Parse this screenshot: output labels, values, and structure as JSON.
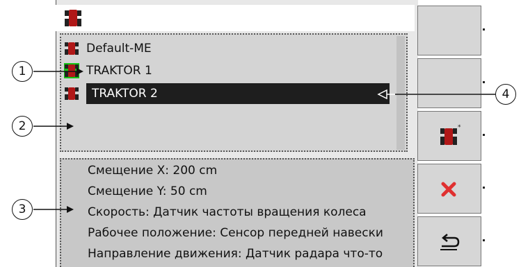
{
  "list": {
    "items": [
      {
        "label": "Default-ME",
        "selected": false,
        "highlighted_icon": false
      },
      {
        "label": "TRAKTOR 1",
        "selected": false,
        "highlighted_icon": true
      },
      {
        "label": "TRAKTOR 2",
        "selected": true,
        "highlighted_icon": false
      }
    ]
  },
  "info": {
    "lines": [
      "Смещение X: 200 cm",
      "Смещение Y: 50 cm",
      "Скорость: Датчик частоты вращения колеса",
      "Рабочее положение: Сенсор передней навески",
      "Направление движения: Датчик радара что-то"
    ]
  },
  "callouts": {
    "c1": "1",
    "c2": "2",
    "c3": "3",
    "c4": "4"
  },
  "softkeys": [
    "",
    "",
    "tractor-new-icon",
    "delete-icon",
    "back-icon"
  ],
  "colors": {
    "selection_bg": "#1e1e1e",
    "icon_highlight": "#15c515",
    "tractor_red": "#b01818",
    "delete_red": "#e03030"
  }
}
